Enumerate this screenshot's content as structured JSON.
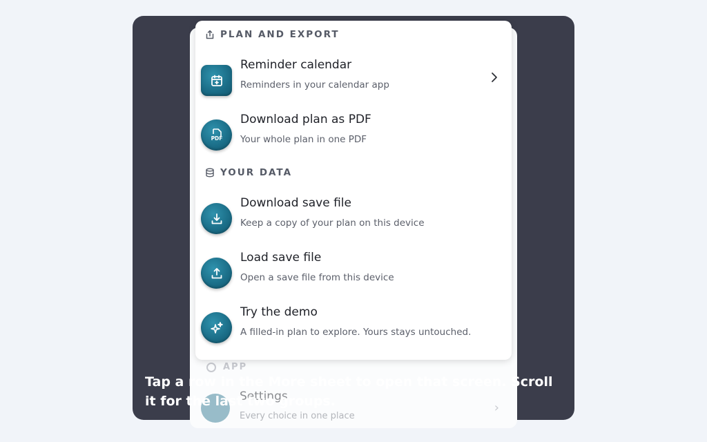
{
  "background_sheet": {
    "section_label": "APP",
    "row_title": "Settings",
    "row_subtitle": "Every choice in one place"
  },
  "sections": {
    "plan_export": {
      "label": "PLAN AND EXPORT",
      "icon": "share-icon"
    },
    "your_data": {
      "label": "YOUR DATA",
      "icon": "database-icon"
    }
  },
  "rows": [
    {
      "title": "Reminder calendar",
      "subtitle": "Reminders in your calendar app",
      "icon": "calendar-plus-icon"
    },
    {
      "title": "Download plan as PDF",
      "subtitle": "Your whole plan in one PDF",
      "icon": "pdf-file-icon"
    },
    {
      "title": "Download save file",
      "subtitle": "Keep a copy of your plan on this device",
      "icon": "download-icon"
    },
    {
      "title": "Load save file",
      "subtitle": "Open a save file from this device",
      "icon": "upload-icon"
    },
    {
      "title": "Try the demo",
      "subtitle": "A filled-in plan to explore. Yours stays untouched.",
      "icon": "sparkles-icon"
    }
  ],
  "pdf_badge_text": "PDF",
  "caption": "Tap a row in the More sheet to open that screen. Scroll it for the last two groups.",
  "colors": {
    "overlay": "#3b3d4b",
    "icon_teal": "#1a6c86",
    "page_bg": "#f1f4f9"
  }
}
